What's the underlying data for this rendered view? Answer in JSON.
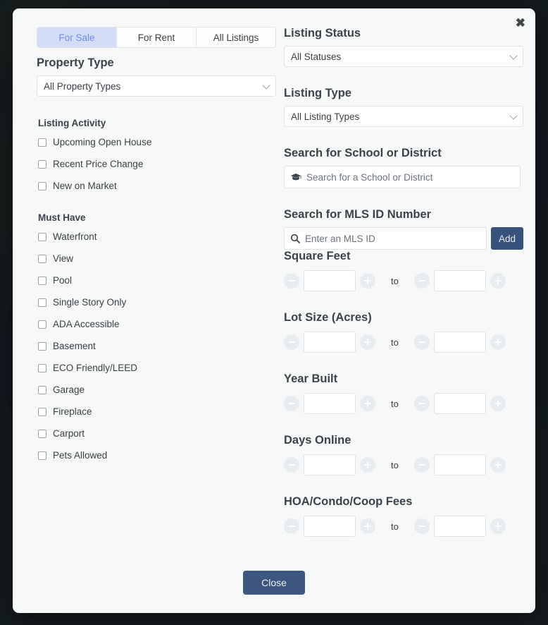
{
  "modal": {
    "close_icon": "close-x-icon",
    "footer_button": "Close"
  },
  "tabs": [
    {
      "label": "For Sale",
      "active": true
    },
    {
      "label": "For Rent",
      "active": false
    },
    {
      "label": "All Listings",
      "active": false
    }
  ],
  "left": {
    "property_type": {
      "heading": "Property Type",
      "value": "All Property Types"
    },
    "listing_activity": {
      "heading": "Listing Activity",
      "items": [
        "Upcoming Open House",
        "Recent Price Change",
        "New on Market"
      ]
    },
    "must_have": {
      "heading": "Must Have",
      "items": [
        "Waterfront",
        "View",
        "Pool",
        "Single Story Only",
        "ADA Accessible",
        "Basement",
        "ECO Friendly/LEED",
        "Garage",
        "Fireplace",
        "Carport",
        "Pets Allowed"
      ]
    }
  },
  "right": {
    "listing_status": {
      "heading": "Listing Status",
      "value": "All Statuses"
    },
    "listing_type": {
      "heading": "Listing Type",
      "value": "All Listing Types"
    },
    "school_search": {
      "heading": "Search for School or District",
      "placeholder": "Search for a School or District",
      "value": "",
      "icon": "graduation-cap-icon"
    },
    "mls_search": {
      "heading": "Search for MLS ID Number",
      "placeholder": "Enter an MLS ID",
      "value": "",
      "icon": "search-icon",
      "add_label": "Add"
    },
    "ranges": [
      {
        "heading": "Square Feet",
        "min": "",
        "max": "",
        "separator": "to"
      },
      {
        "heading": "Lot Size (Acres)",
        "min": "",
        "max": "",
        "separator": "to"
      },
      {
        "heading": "Year Built",
        "min": "",
        "max": "",
        "separator": "to"
      },
      {
        "heading": "Days Online",
        "min": "",
        "max": "",
        "separator": "to"
      },
      {
        "heading": "HOA/Condo/Coop Fees",
        "min": "",
        "max": "",
        "separator": "to"
      }
    ]
  },
  "colors": {
    "accent_navy": "#36537d",
    "tab_active_bg": "#d3ddf7",
    "tab_active_text": "#6b8ce8",
    "modal_bg": "#f7f8f8",
    "border": "#dfe2e6",
    "text": "#3b4046",
    "stepper_bg": "#e8ebf0"
  }
}
